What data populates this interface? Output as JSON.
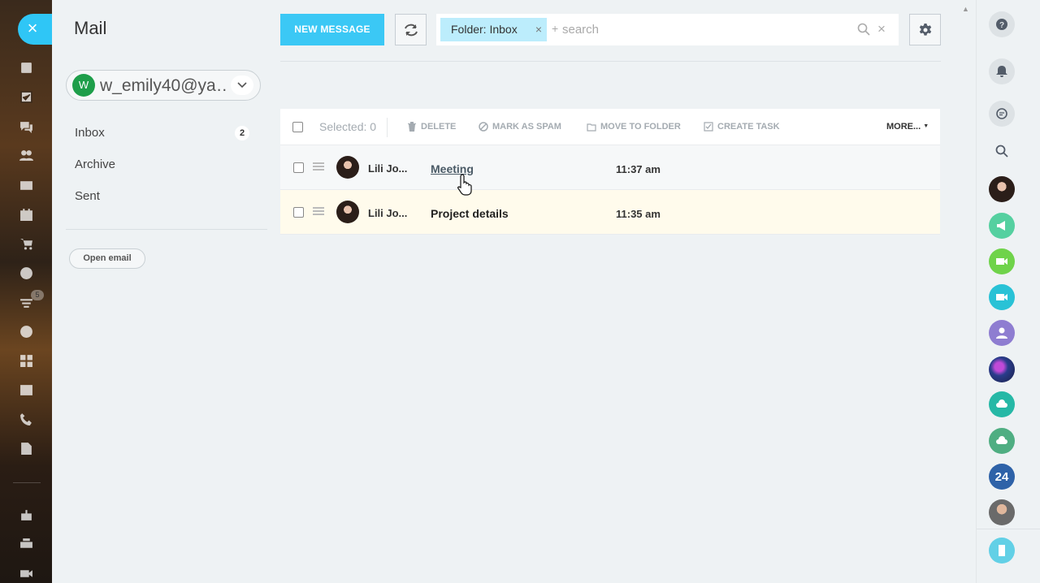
{
  "left_rail": {
    "close_label": "×",
    "badge": "5",
    "icons": [
      "feed-icon",
      "tasks-icon",
      "chat-icon",
      "groups-icon",
      "contacts-icon",
      "calendar-icon",
      "shop-icon",
      "time-icon",
      "filter-icon",
      "target-icon",
      "apps-icon",
      "sites-icon",
      "phone-icon",
      "document-icon",
      "robot-icon",
      "printer-icon",
      "video-icon"
    ]
  },
  "sidebar": {
    "title": "Mail",
    "account": {
      "initial": "W",
      "email": "w_emily40@ya…"
    },
    "folders": [
      {
        "label": "Inbox",
        "count": "2"
      },
      {
        "label": "Archive"
      },
      {
        "label": "Sent"
      }
    ],
    "open_email_label": "Open email"
  },
  "toolbar": {
    "new_message_label": "NEW MESSAGE",
    "folder_tag": "Folder: Inbox",
    "folder_tag_remove": "×",
    "search_plus": "+",
    "search_placeholder": "search",
    "search_clear": "×"
  },
  "grid": {
    "selected_label": "Selected: 0",
    "actions": {
      "delete": "DELETE",
      "spam": "MARK AS SPAM",
      "move": "MOVE TO FOLDER",
      "task": "CREATE TASK",
      "more": "MORE..."
    },
    "rows": [
      {
        "sender": "Lili Jo...",
        "subject": "Meeting",
        "time": "11:37 am"
      },
      {
        "sender": "Lili Jo...",
        "subject": "Project details",
        "time": "11:35 am"
      }
    ]
  },
  "right_rail": {
    "badge_24": "24"
  },
  "colors": {
    "accent": "#3bc8f5",
    "tag": "#bcedfc",
    "green": "#55d0a0",
    "teal": "#29c2d6",
    "purple": "#8e7dd1",
    "navy": "#2e62a8"
  }
}
